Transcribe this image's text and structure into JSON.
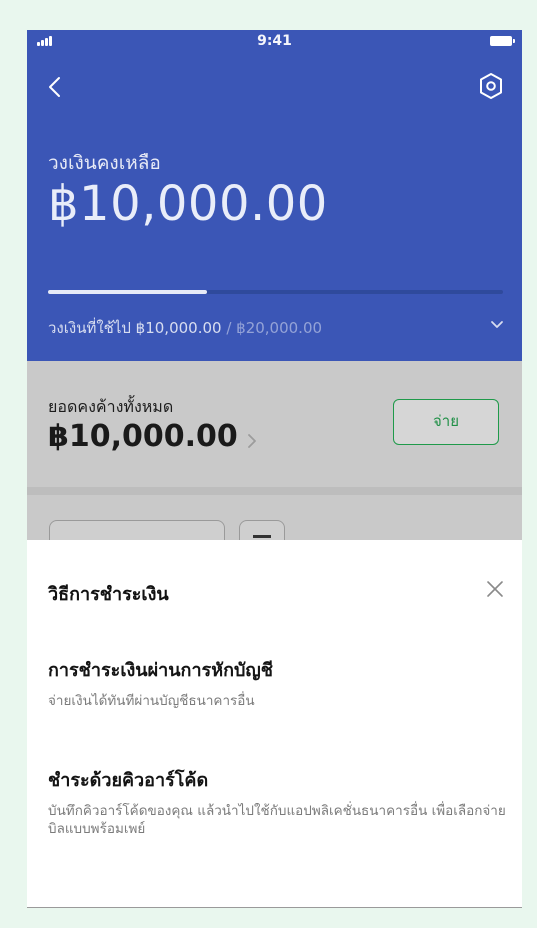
{
  "status_bar": {
    "time": "9:41"
  },
  "header": {
    "remaining_label": "วงเงินคงเหลือ",
    "remaining_amount": "฿10,000.00",
    "used_label": "วงเงินที่ใช้ไป ฿10,000.00",
    "total_limit": " / ฿20,000.00",
    "progress": 0.35
  },
  "balance": {
    "label": "ยอดคงค้างทั้งหมด",
    "amount": "฿10,000.00",
    "pay_button": "จ่าย"
  },
  "sheet": {
    "title": "วิธีการชำระเงิน",
    "options": [
      {
        "title": "การชำระเงินผ่านการหักบัญชี",
        "description": "จ่ายเงินได้ทันทีผ่านบัญชีธนาคารอื่น"
      },
      {
        "title": "ชำระด้วยคิวอาร์โค้ด",
        "description": "บันทึกคิวอาร์โค้ดของคุณ แล้วนำไปใช้กับแอปพลิเคชั่นธนาคารอื่น เพื่อเลือกจ่ายบิลแบบพร้อมเพย์"
      }
    ]
  },
  "colors": {
    "header_bg": "#3b56b6",
    "accent_green": "#1f9a4a",
    "page_bg": "#e9f7ee"
  }
}
